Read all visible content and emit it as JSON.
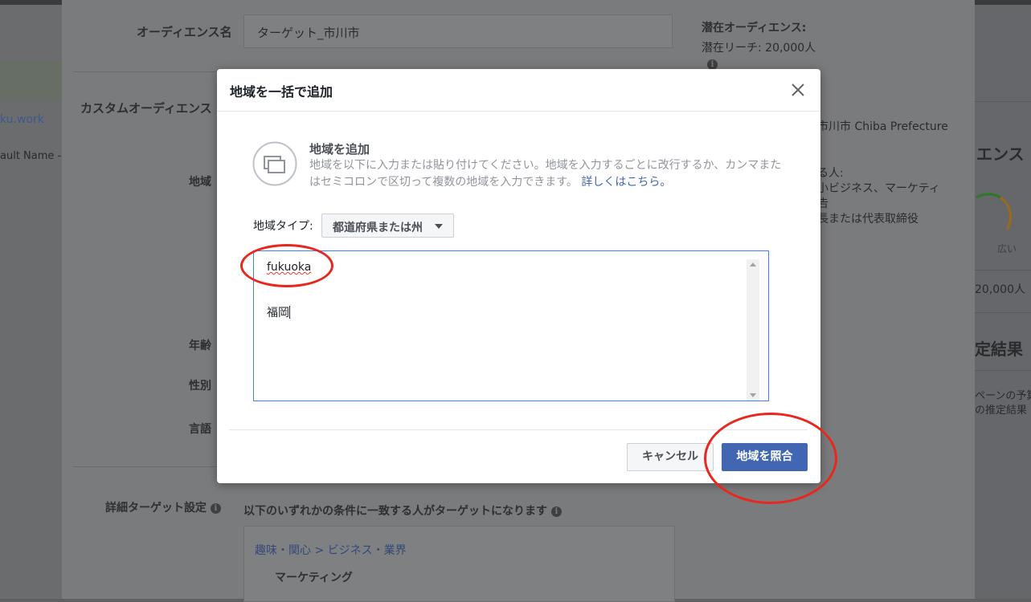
{
  "background": {
    "left": {
      "link_text": "ku.work",
      "default_name": "ault Name -"
    },
    "page": {
      "audience_name_label": "オーディエンス名",
      "audience_name_value": "ターゲット_市川市",
      "custom_audience_label": "カスタムオーディエンス",
      "region_label": "地域",
      "age_label": "年齢",
      "gender_label": "性別",
      "language_label": "言語",
      "detailed_targeting_label": "詳細ターゲット設定",
      "detailed_targeting_desc": "以下のいずれかの条件に一致する人がターゲットになります",
      "breadcrumb": "趣味・関心 > ビジネス・業界",
      "interest_item": "マーケティング",
      "potential_audience_title": "潜在オーディエンス:",
      "potential_reach": "潜在リーチ: 20,000人",
      "location_summary": "市川市 Chiba Prefecture",
      "people_label": "る人:",
      "summary_line1": "小ビジネス、マーケティ",
      "summary_line2": "告",
      "summary_line3": "長または代表取締役"
    },
    "right": {
      "audience_heading": "エンス",
      "gauge_label": "広い",
      "reach_count": "20,000人",
      "results_heading": "定結果",
      "campaign_line": "ペーンの予算",
      "estimate_line": "の推定結果"
    }
  },
  "modal": {
    "title": "地域を一括で追加",
    "add_title": "地域を追加",
    "add_description": "地域を以下に入力または貼り付けてください。地域を入力するごとに改行するか、カンマまたはセミコロンで区切って複数の地域を入力できます。",
    "learn_more": "詳しくはこちら。",
    "location_type_label": "地域タイプ:",
    "location_type_value": "都道府県または州",
    "textarea_lines": [
      "fukuoka",
      "",
      "福岡"
    ],
    "cancel_label": "キャンセル",
    "match_label": "地域を照合"
  },
  "colors": {
    "primary_button": "#4267b2",
    "textarea_focus_border": "#4080ff",
    "annotation_red": "#e8281e",
    "gauge_green": "#42b72a",
    "gauge_orange": "#f7a11a"
  }
}
